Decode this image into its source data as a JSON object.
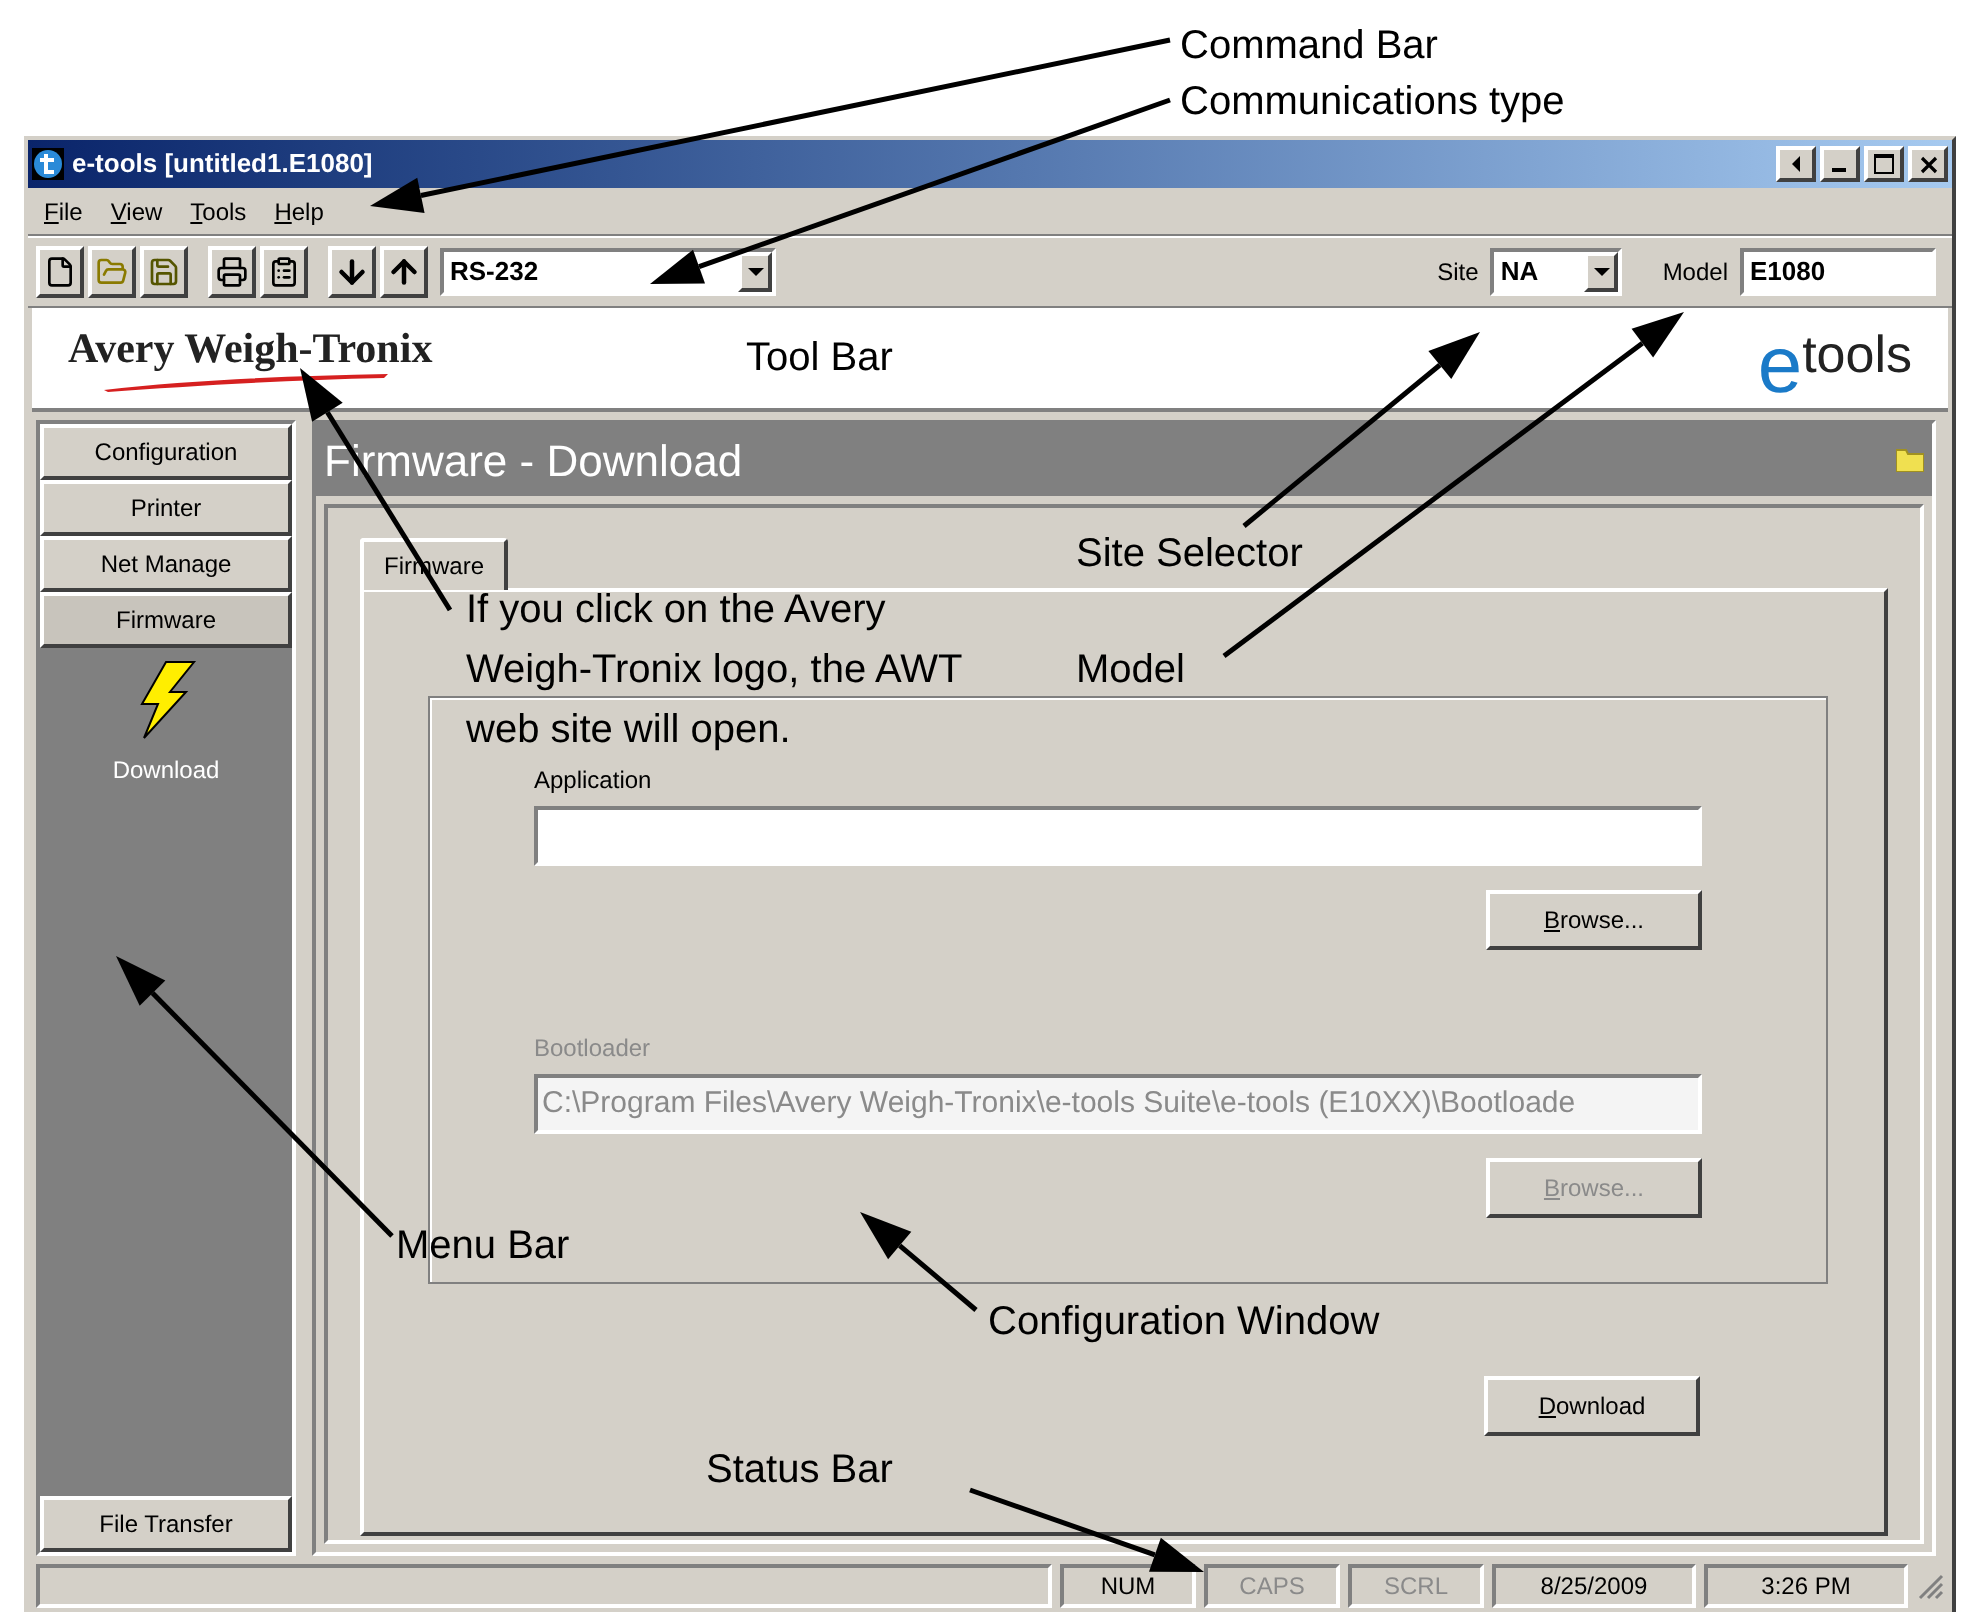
{
  "callouts": [
    {
      "text": "Command Bar"
    },
    {
      "text": "Communications type"
    },
    {
      "text": "Tool Bar"
    },
    {
      "text": "If you click on the Avery Weigh-Tronix logo, the AWT web site will open."
    },
    {
      "text": "Site Selector"
    },
    {
      "text": "Model"
    },
    {
      "text": "Menu Bar"
    },
    {
      "text": "Configuration Window"
    },
    {
      "text": "Status Bar"
    }
  ],
  "window": {
    "title": "e-tools [untitled1.E1080]"
  },
  "menu": [
    "File",
    "View",
    "Tools",
    "Help"
  ],
  "toolbar": {
    "comm_type": "RS-232",
    "site_label": "Site",
    "site": "NA",
    "model_label": "Model",
    "model": "E1080"
  },
  "banner": {
    "company_logo": "Avery Weigh-Tronix",
    "product_logo_mark": "e",
    "product_logo_word": "tools"
  },
  "sidebar": {
    "items": [
      {
        "label": "Configuration",
        "selected": false
      },
      {
        "label": "Printer",
        "selected": false
      },
      {
        "label": "Net Manage",
        "selected": false
      },
      {
        "label": "Firmware",
        "selected": true
      }
    ],
    "panel_items": [
      {
        "label": "Download",
        "selected": true
      }
    ],
    "bottom_item": "File Transfer"
  },
  "main": {
    "header": "Firmware - Download",
    "tabs": [
      {
        "label": "Firmware",
        "selected": true
      }
    ],
    "fields": [
      {
        "label": "Application",
        "disabled": false,
        "button": "Browse..."
      },
      {
        "label": "Bootloader",
        "value": "C:\\Program Files\\Avery Weigh-Tronix\\e-tools Suite\\e-tools (E10XX)\\Bootloade",
        "disabled": true,
        "button": "Browse..."
      }
    ],
    "action_button": "Download"
  },
  "status_bar": [
    {
      "text": "NUM",
      "disabled": false
    },
    {
      "text": "CAPS",
      "disabled": true
    },
    {
      "text": "SCRL",
      "disabled": true
    },
    {
      "text": "8/25/2009",
      "disabled": false
    },
    {
      "text": "3:26 PM",
      "disabled": false
    }
  ]
}
